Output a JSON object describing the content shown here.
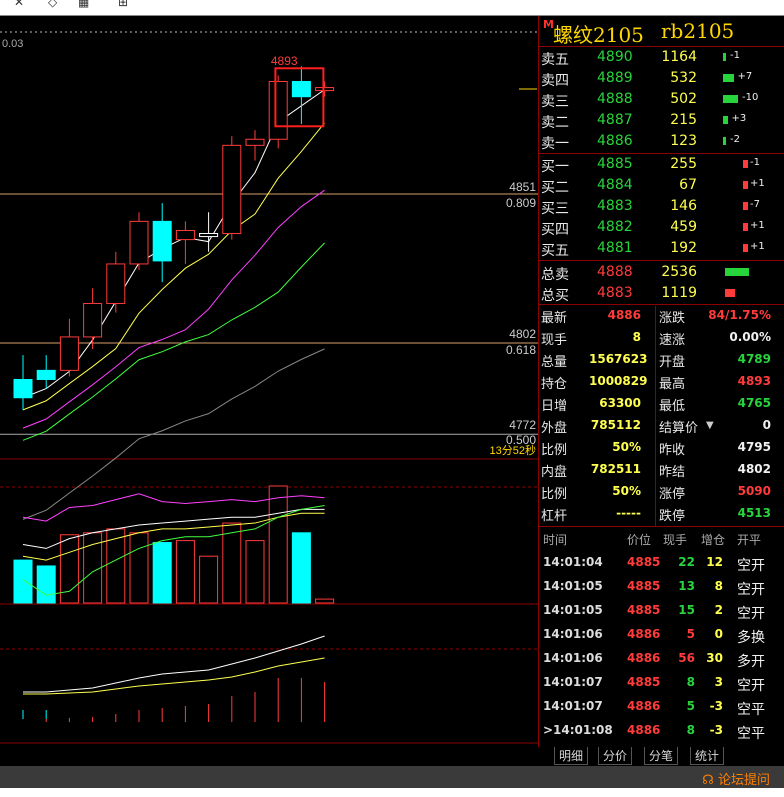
{
  "topbar": {
    "left_text": "0.03"
  },
  "instrument": {
    "badge": "M",
    "name": "螺纹2105",
    "code": "rb2105"
  },
  "chart_labels": {
    "high_marker": "4893",
    "price_4851": "4851",
    "ratio_0809": "0.809",
    "price_4802": "4802",
    "ratio_0618": "0.618",
    "price_4772": "4772",
    "ratio_0500": "0.500",
    "countdown": "13分52秒",
    "top_left_value": "0.03"
  },
  "orderbook": {
    "asks": [
      {
        "label": "卖五",
        "price": "4890",
        "volume": "1164",
        "change": "-1"
      },
      {
        "label": "卖四",
        "price": "4889",
        "volume": "532",
        "change": "+7"
      },
      {
        "label": "卖三",
        "price": "4888",
        "volume": "502",
        "change": "-10"
      },
      {
        "label": "卖二",
        "price": "4887",
        "volume": "215",
        "change": "+3"
      },
      {
        "label": "卖一",
        "price": "4886",
        "volume": "123",
        "change": "-2"
      }
    ],
    "bids": [
      {
        "label": "买一",
        "price": "4885",
        "volume": "255",
        "change": "-1"
      },
      {
        "label": "买二",
        "price": "4884",
        "volume": "67",
        "change": "+1"
      },
      {
        "label": "买三",
        "price": "4883",
        "volume": "146",
        "change": "-7"
      },
      {
        "label": "买四",
        "price": "4882",
        "volume": "459",
        "change": "+1"
      },
      {
        "label": "买五",
        "price": "4881",
        "volume": "192",
        "change": "+1"
      }
    ],
    "total_sell": {
      "label": "总卖",
      "price": "4888",
      "volume": "2536"
    },
    "total_buy": {
      "label": "总买",
      "price": "4883",
      "volume": "1119"
    }
  },
  "stats": [
    {
      "l1": "最新",
      "v1": "4886",
      "l2": "涨跌",
      "v2": "84/1.75%"
    },
    {
      "l1": "现手",
      "v1": "8",
      "l2": "速涨",
      "v2": "0.00%"
    },
    {
      "l1": "总量",
      "v1": "1567623",
      "l2": "开盘",
      "v2": "4789"
    },
    {
      "l1": "持仓",
      "v1": "1000829",
      "l2": "最高",
      "v2": "4893"
    },
    {
      "l1": "日增",
      "v1": "63300",
      "l2": "最低",
      "v2": "4765"
    },
    {
      "l1": "外盘",
      "v1": "785112",
      "l2": "结算价",
      "v2": "0"
    },
    {
      "l1": "比例",
      "v1": "50%",
      "l2": "昨收",
      "v2": "4795"
    },
    {
      "l1": "内盘",
      "v1": "782511",
      "l2": "昨结",
      "v2": "4802"
    },
    {
      "l1": "比例",
      "v1": "50%",
      "l2": "涨停",
      "v2": "5090"
    },
    {
      "l1": "杠杆",
      "v1": "-----",
      "l2": "跌停",
      "v2": "4513"
    }
  ],
  "trades_header": {
    "time": "时间",
    "price": "价位",
    "qty": "现手",
    "oi": "增仓",
    "type": "开平"
  },
  "trades": [
    {
      "time": "14:01:04",
      "price": "4885",
      "qty": "22",
      "oi": "12",
      "type": "空开"
    },
    {
      "time": "14:01:05",
      "price": "4885",
      "qty": "13",
      "oi": "8",
      "type": "空开"
    },
    {
      "time": "14:01:05",
      "price": "4885",
      "qty": "15",
      "oi": "2",
      "type": "空开"
    },
    {
      "time": "14:01:06",
      "price": "4886",
      "qty": "5",
      "oi": "0",
      "type": "多换"
    },
    {
      "time": "14:01:06",
      "price": "4886",
      "qty": "56",
      "oi": "30",
      "type": "多开"
    },
    {
      "time": "14:01:07",
      "price": "4885",
      "qty": "8",
      "oi": "3",
      "type": "空开"
    },
    {
      "time": "14:01:07",
      "price": "4886",
      "qty": "5",
      "oi": "-3",
      "type": "空平"
    },
    {
      "time": ">14:01:08",
      "price": "4886",
      "qty": "8",
      "oi": "-3",
      "type": "空平"
    }
  ],
  "tabs": [
    "明细",
    "分价",
    "分笔",
    "统计"
  ],
  "status": {
    "forum": "论坛提问"
  },
  "colors": {
    "up": "#ff3b3b",
    "down": "#00ffff",
    "panel_border": "#8b0000",
    "accent": "#ffd700"
  },
  "chart_data": {
    "type": "candlestick",
    "y_levels": [
      4851,
      4802,
      4772
    ],
    "high_label": 4893,
    "candles": [
      {
        "o": 4790,
        "h": 4798,
        "l": 4780,
        "c": 4784,
        "dir": "down"
      },
      {
        "o": 4793,
        "h": 4798,
        "l": 4787,
        "c": 4790,
        "dir": "down"
      },
      {
        "o": 4793,
        "h": 4810,
        "l": 4791,
        "c": 4804,
        "dir": "up"
      },
      {
        "o": 4804,
        "h": 4820,
        "l": 4800,
        "c": 4815,
        "dir": "up"
      },
      {
        "o": 4815,
        "h": 4832,
        "l": 4812,
        "c": 4828,
        "dir": "up"
      },
      {
        "o": 4828,
        "h": 4845,
        "l": 4826,
        "c": 4842,
        "dir": "up"
      },
      {
        "o": 4842,
        "h": 4848,
        "l": 4822,
        "c": 4829,
        "dir": "down"
      },
      {
        "o": 4836,
        "h": 4842,
        "l": 4828,
        "c": 4839,
        "dir": "up"
      },
      {
        "o": 4837,
        "h": 4845,
        "l": 4832,
        "c": 4838,
        "dir": "flat"
      },
      {
        "o": 4838,
        "h": 4870,
        "l": 4836,
        "c": 4867,
        "dir": "up"
      },
      {
        "o": 4867,
        "h": 4872,
        "l": 4862,
        "c": 4869,
        "dir": "up"
      },
      {
        "o": 4869,
        "h": 4890,
        "l": 4866,
        "c": 4888,
        "dir": "up"
      },
      {
        "o": 4888,
        "h": 4893,
        "l": 4874,
        "c": 4883,
        "dir": "down"
      },
      {
        "o": 4886,
        "h": 4888,
        "l": 4883,
        "c": 4885,
        "dir": "up"
      }
    ],
    "volume": [
      22,
      19,
      35,
      36,
      38,
      36,
      31,
      32,
      24,
      41,
      32,
      60,
      36,
      2
    ],
    "volume_dir": [
      "down",
      "down",
      "up",
      "up",
      "up",
      "up",
      "down",
      "up",
      "up",
      "up",
      "up",
      "up",
      "down",
      "up"
    ]
  }
}
